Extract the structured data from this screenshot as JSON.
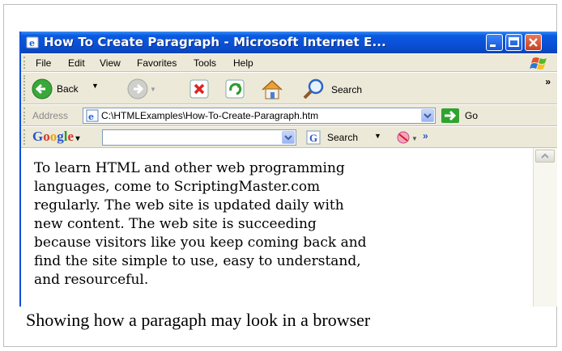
{
  "window": {
    "title": "How To Create Paragraph - Microsoft Internet E..."
  },
  "menu": [
    "File",
    "Edit",
    "View",
    "Favorites",
    "Tools",
    "Help"
  ],
  "toolbar": {
    "back_label": "Back",
    "search_label": "Search"
  },
  "address": {
    "label": "Address",
    "value": "C:\\HTMLExamples\\How-To-Create-Paragraph.htm",
    "go_label": "Go"
  },
  "google_toolbar": {
    "search_label": "Search",
    "chevrons": "»"
  },
  "page": {
    "lines": [
      "To learn HTML and other web programming",
      "languages, come to ScriptingMaster.com",
      "regularly. The web site is updated daily with",
      "new content. The web site is succeeding",
      "because visitors like you keep coming back and",
      "find the site simple to use, easy to understand,",
      "and resourceful."
    ]
  },
  "caption": "Showing how a paragaph may look in a browser",
  "colors": {
    "titlebar": "#0a4fd6",
    "chrome": "#ece9d8",
    "close_button": "#c64121"
  },
  "icons": [
    "ie-icon",
    "minimize-icon",
    "maximize-icon",
    "close-icon",
    "windows-logo-icon",
    "back-icon",
    "forward-icon",
    "stop-icon",
    "refresh-icon",
    "home-icon",
    "search-icon",
    "page-icon",
    "go-arrow-icon",
    "google-search-icon",
    "popup-blocker-icon"
  ]
}
